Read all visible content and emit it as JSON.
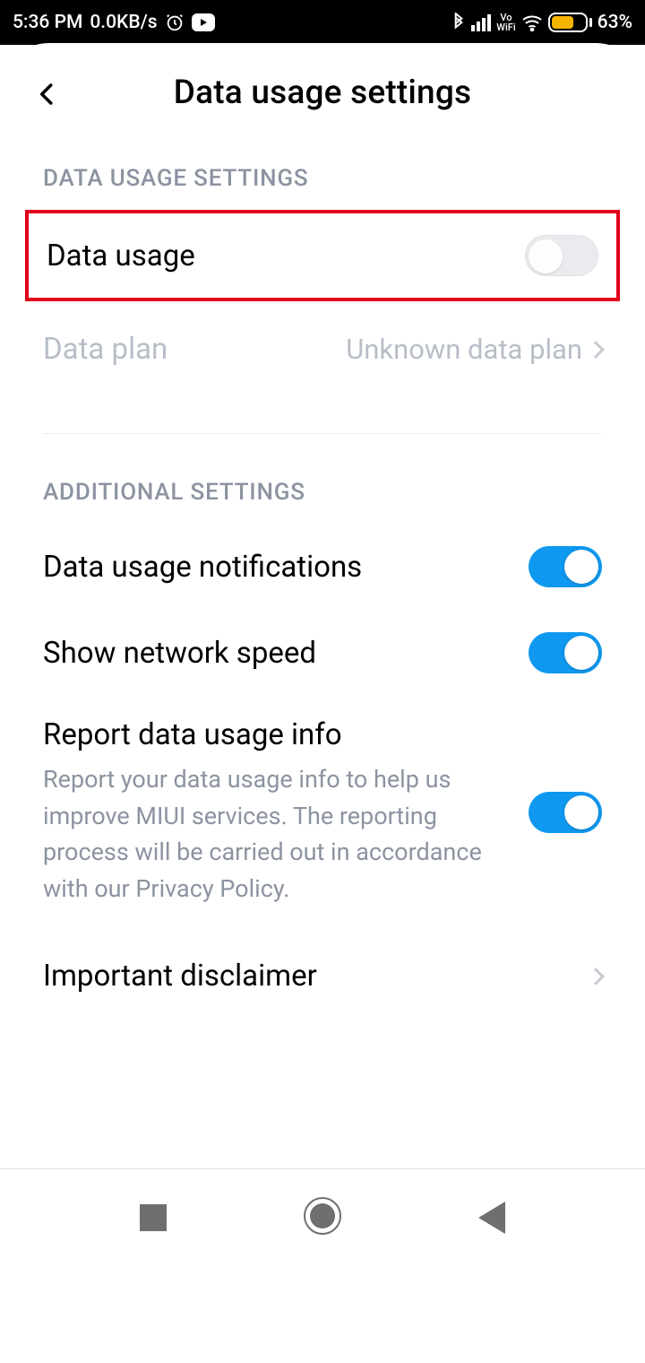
{
  "status": {
    "time": "5:36 PM",
    "net_speed": "0.0KB/s",
    "battery_pct": "63%",
    "vo_wifi": "Vo\nWiFi"
  },
  "header": {
    "title": "Data usage settings"
  },
  "sections": {
    "primary_header": "DATA USAGE SETTINGS",
    "additional_header": "ADDITIONAL SETTINGS"
  },
  "rows": {
    "data_usage": {
      "label": "Data usage"
    },
    "data_plan": {
      "label": "Data plan",
      "value": "Unknown data plan"
    },
    "notifications": {
      "label": "Data usage notifications"
    },
    "net_speed": {
      "label": "Show network speed"
    },
    "report": {
      "label": "Report data usage info",
      "desc": "Report your data usage info to help us improve MIUI services. The reporting process will be carried out in accordance with our Privacy Policy."
    },
    "disclaimer": {
      "label": "Important disclaimer"
    }
  }
}
